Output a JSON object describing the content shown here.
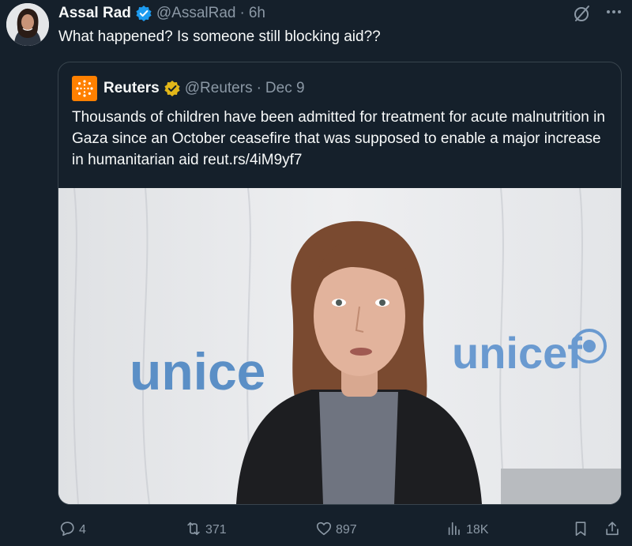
{
  "tweet": {
    "author_name": "Assal Rad",
    "author_handle": "@AssalRad",
    "separator": "·",
    "time": "6h",
    "text": "What happened? Is someone still blocking aid??"
  },
  "quoted": {
    "author_name": "Reuters",
    "author_handle": "@Reuters",
    "separator": "·",
    "date": "Dec 9",
    "text": "Thousands of children have been admitted for treatment for acute malnutrition in Gaza since an October ceasefire that was supposed to enable a major increase in humanitarian aid reut.rs/4iM9yf7",
    "media": {
      "banner_text_left": "unice",
      "banner_text_right": "unicef"
    }
  },
  "actions": {
    "replies": "4",
    "reposts": "371",
    "likes": "897",
    "views": "18K"
  },
  "colors": {
    "background": "#15202b",
    "verified_blue": "#1d9bf0",
    "verified_gold": "#e2b719",
    "reuters_orange": "#ff8000",
    "muted_text": "#8b98a5"
  }
}
